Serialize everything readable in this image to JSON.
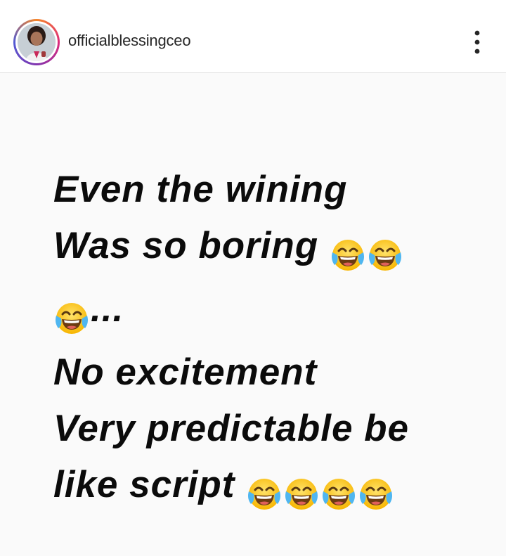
{
  "post_header": {
    "username": "officialblessingceo",
    "avatar_icon": "profile-photo",
    "more_icon": "more-vertical-icon"
  },
  "post": {
    "lines": [
      {
        "text": "Even the wining",
        "emoji_count": 0
      },
      {
        "text": "Was so boring ",
        "emoji_count": 2
      },
      {
        "text": "...",
        "emoji_count": 1,
        "emoji_first": true
      },
      {
        "text": "No excitement",
        "emoji_count": 0
      },
      {
        "text": "Very predictable be",
        "emoji_count": 0
      },
      {
        "text": "like script ",
        "emoji_count": 4
      }
    ],
    "emoji_icon": "face-with-tears-of-joy-icon"
  },
  "colors": {
    "text": "#0b0b0b",
    "background": "#fafafa",
    "username": "#262626"
  }
}
